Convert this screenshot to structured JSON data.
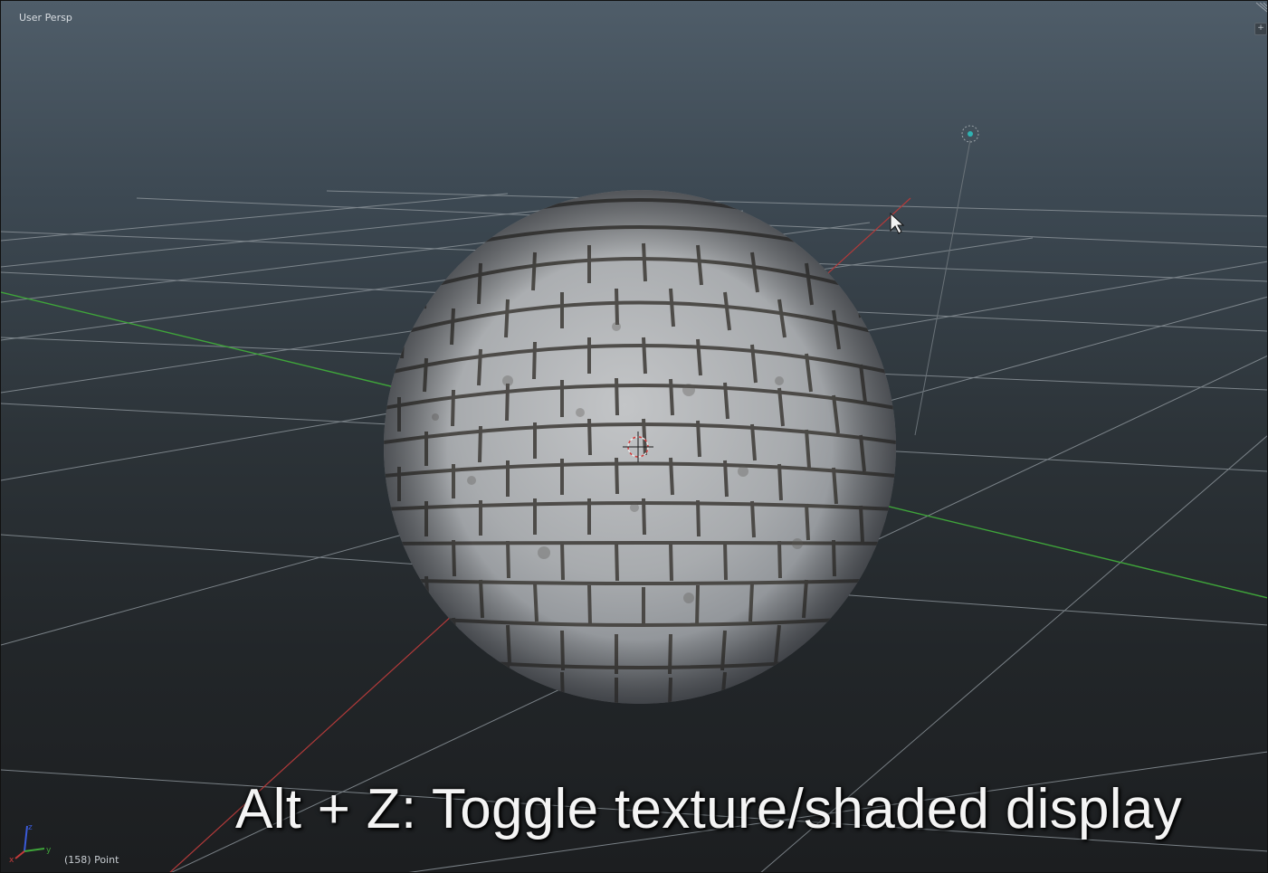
{
  "viewport": {
    "view_label": "User Persp",
    "object_info": "(158) Point",
    "caption": "Alt + Z: Toggle texture/shaded display",
    "mouse_cursor": "arrow-pointer-icon",
    "colors": {
      "background_top": "#4f5d69",
      "background_bottom": "#1c1e20",
      "grid": "#8a9298",
      "x_axis": "#b23a3a",
      "y_axis": "#3fa53a",
      "stone": "#a9aaa8",
      "mortar": "#3d3a36"
    },
    "axis_gizmo": {
      "x_label": "x",
      "y_label": "y",
      "z_label": "z"
    },
    "corner_button": "+"
  }
}
